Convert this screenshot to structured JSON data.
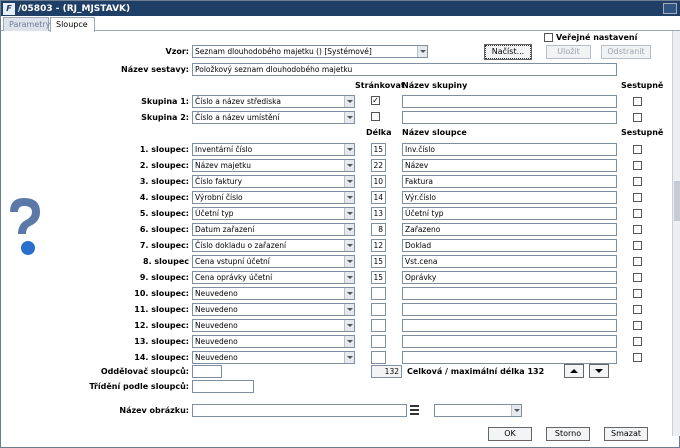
{
  "window": {
    "title": "/05803 - (RJ_MJSTAVK)"
  },
  "tabs": [
    {
      "label": "Parametry"
    },
    {
      "label": "Sloupce"
    }
  ],
  "form": {
    "vzor_label": "Vzor:",
    "vzor_value": "Seznam dlouhodobého majetku  ()  [Systémové]",
    "nazev_label": "Název sestavy:",
    "nazev_value": "Položkový seznam dlouhodobého majetku",
    "verejne_label": "Veřejné nastavení",
    "btn_nacist": "Načíst...",
    "btn_ulozit": "Uložit",
    "btn_odstranit": "Odstranit"
  },
  "headers": {
    "strankovat": "Stránkovat",
    "nazev_skupiny": "Název skupiny",
    "sestupne1": "Sestupně",
    "delka": "Délka",
    "nazev_sloupce": "Název sloupce",
    "sestupne2": "Sestupně"
  },
  "groups": [
    {
      "label": "Skupina 1:",
      "value": "Číslo a název střediska",
      "strankovat": true,
      "name": ""
    },
    {
      "label": "Skupina 2:",
      "value": "Číslo a název umístění",
      "strankovat": false,
      "name": ""
    }
  ],
  "columns": [
    {
      "label": "1. sloupec:",
      "value": "Inventární číslo",
      "len": "15",
      "name": "Inv.číslo"
    },
    {
      "label": "2. sloupec:",
      "value": "Název majetku",
      "len": "22",
      "name": "Název"
    },
    {
      "label": "3. sloupec:",
      "value": "Číslo faktury",
      "len": "10",
      "name": "Faktura"
    },
    {
      "label": "4. sloupec:",
      "value": "Výrobní číslo",
      "len": "14",
      "name": "Výr.číslo"
    },
    {
      "label": "5. sloupec:",
      "value": "Účetní typ",
      "len": "13",
      "name": "Účetní typ"
    },
    {
      "label": "6. sloupec:",
      "value": "Datum zařazení",
      "len": "8",
      "name": "Zařazeno"
    },
    {
      "label": "7. sloupec:",
      "value": "Číslo dokladu o zařazení",
      "len": "12",
      "name": "Doklad"
    },
    {
      "label": "8. sloupec",
      "value": "Cena vstupní účetní",
      "len": "15",
      "name": "Vst.cena"
    },
    {
      "label": "9. sloupec:",
      "value": "Cena oprávky účetní",
      "len": "15",
      "name": "Oprávky"
    },
    {
      "label": "10. sloupec:",
      "value": "Neuvedeno",
      "len": "",
      "name": ""
    },
    {
      "label": "11. sloupec:",
      "value": "Neuvedeno",
      "len": "",
      "name": ""
    },
    {
      "label": "12. sloupec:",
      "value": "Neuvedeno",
      "len": "",
      "name": ""
    },
    {
      "label": "13. sloupec:",
      "value": "Neuvedeno",
      "len": "",
      "name": ""
    },
    {
      "label": "14. sloupec:",
      "value": "Neuvedeno",
      "len": "",
      "name": ""
    }
  ],
  "footer": {
    "oddelovac_label": "Oddělovač sloupců:",
    "trideni_label": "Třídění podle sloupců:",
    "total_value": "132",
    "total_label": "Celková / maximální délka 132",
    "obrazek_label": "Název obrázku:",
    "btn_ok": "OK",
    "btn_storno": "Storno",
    "btn_smazat": "Smazat"
  }
}
